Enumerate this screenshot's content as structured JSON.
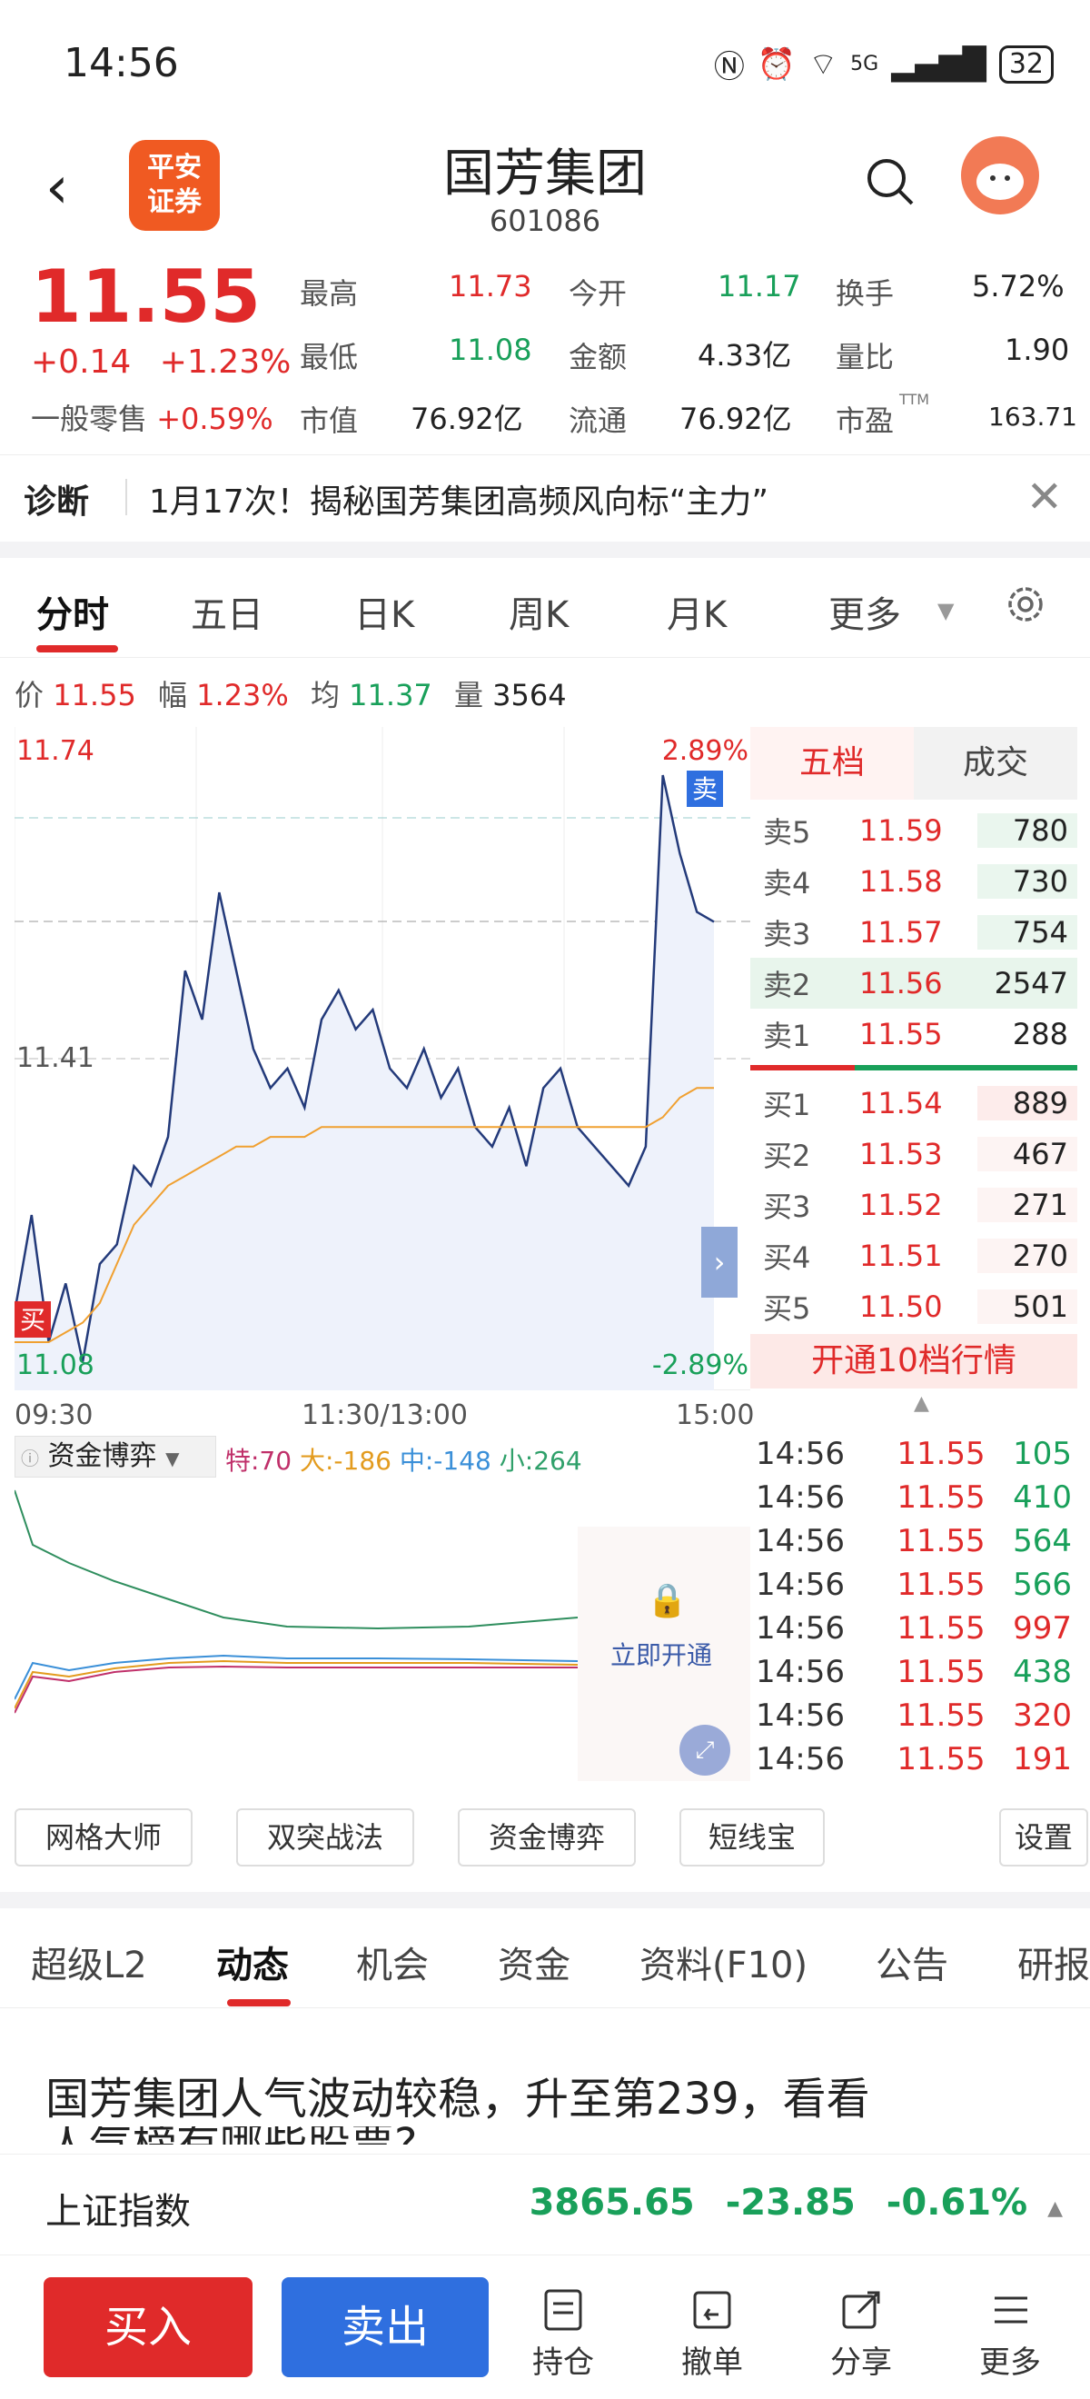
{
  "status_bar": {
    "time": "14:56",
    "network": "5G",
    "battery": "32"
  },
  "header": {
    "stock_name": "国芳集团",
    "stock_code": "601086",
    "logo_line1": "平安",
    "logo_line2": "证券"
  },
  "quote": {
    "price": "11.55",
    "change": "+0.14",
    "change_pct": "+1.23%",
    "retail_label": "一般零售",
    "retail_pct": "+0.59%",
    "high_label": "最高",
    "high": "11.73",
    "low_label": "最低",
    "low": "11.08",
    "cap_label": "市值",
    "cap": "76.92亿",
    "open_label": "今开",
    "open": "11.17",
    "amount_label": "金额",
    "amount": "4.33亿",
    "float_label": "流通",
    "float": "76.92亿",
    "turnover_label": "换手",
    "turnover": "5.72%",
    "vr_label": "量比",
    "vr": "1.90",
    "pe_label": "市盈",
    "pe_sup": "TTM",
    "pe": "163.71"
  },
  "diagnosis": {
    "label": "诊断",
    "text": "1月17次！揭秘国芳集团高频风向标“主力”"
  },
  "tabs": [
    "分时",
    "五日",
    "日K",
    "周K",
    "月K",
    "更多"
  ],
  "info_line": {
    "price_label": "价",
    "price": "11.55",
    "amp_label": "幅",
    "amp": "1.23%",
    "avg_label": "均",
    "avg": "11.37",
    "vol_label": "量",
    "vol": "3564"
  },
  "chart_labels": {
    "top_price": "11.74",
    "mid_price": "11.41",
    "bottom_price": "11.08",
    "top_pct": "2.89%",
    "bottom_pct": "-2.89%",
    "sell_marker": "卖",
    "buy_marker": "买"
  },
  "chart_data": {
    "type": "line",
    "x_ticks": [
      "09:30",
      "11:30/13:00",
      "15:00"
    ],
    "ylim": [
      11.08,
      11.74
    ],
    "series": [
      {
        "name": "价",
        "values": [
          11.15,
          11.25,
          11.12,
          11.18,
          11.1,
          11.2,
          11.22,
          11.3,
          11.28,
          11.33,
          11.5,
          11.45,
          11.58,
          11.5,
          11.42,
          11.38,
          11.4,
          11.36,
          11.45,
          11.48,
          11.44,
          11.46,
          11.4,
          11.38,
          11.42,
          11.37,
          11.4,
          11.34,
          11.32,
          11.36,
          11.3,
          11.38,
          11.4,
          11.34,
          11.32,
          11.3,
          11.28,
          11.32,
          11.7,
          11.62,
          11.56,
          11.55
        ]
      },
      {
        "name": "均",
        "values": [
          11.12,
          11.12,
          11.12,
          11.13,
          11.14,
          11.16,
          11.2,
          11.24,
          11.26,
          11.28,
          11.29,
          11.3,
          11.31,
          11.32,
          11.32,
          11.33,
          11.33,
          11.33,
          11.34,
          11.34,
          11.34,
          11.34,
          11.34,
          11.34,
          11.34,
          11.34,
          11.34,
          11.34,
          11.34,
          11.34,
          11.34,
          11.34,
          11.34,
          11.34,
          11.34,
          11.34,
          11.34,
          11.34,
          11.35,
          11.37,
          11.38,
          11.38
        ]
      }
    ]
  },
  "order_book": {
    "tab_five": "五档",
    "tab_trades": "成交",
    "asks": [
      {
        "label": "卖5",
        "price": "11.59",
        "vol": "780"
      },
      {
        "label": "卖4",
        "price": "11.58",
        "vol": "730"
      },
      {
        "label": "卖3",
        "price": "11.57",
        "vol": "754"
      },
      {
        "label": "卖2",
        "price": "11.56",
        "vol": "2547"
      },
      {
        "label": "卖1",
        "price": "11.55",
        "vol": "288"
      }
    ],
    "bids": [
      {
        "label": "买1",
        "price": "11.54",
        "vol": "889"
      },
      {
        "label": "买2",
        "price": "11.53",
        "vol": "467"
      },
      {
        "label": "买3",
        "price": "11.52",
        "vol": "271"
      },
      {
        "label": "买4",
        "price": "11.51",
        "vol": "270"
      },
      {
        "label": "买5",
        "price": "11.50",
        "vol": "501"
      }
    ],
    "open10": "开通10档行情"
  },
  "fund_panel": {
    "title": "资金博弈",
    "special": "特:70",
    "large": "大:-186",
    "medium": "中:-148",
    "small": "小:264",
    "unlock": "立即开通"
  },
  "trades": [
    {
      "time": "14:56",
      "price": "11.55",
      "vol": "105",
      "color": "green"
    },
    {
      "time": "14:56",
      "price": "11.55",
      "vol": "410",
      "color": "green"
    },
    {
      "time": "14:56",
      "price": "11.55",
      "vol": "564",
      "color": "green"
    },
    {
      "time": "14:56",
      "price": "11.55",
      "vol": "566",
      "color": "green"
    },
    {
      "time": "14:56",
      "price": "11.55",
      "vol": "997",
      "color": "red"
    },
    {
      "time": "14:56",
      "price": "11.55",
      "vol": "438",
      "color": "green"
    },
    {
      "time": "14:56",
      "price": "11.55",
      "vol": "320",
      "color": "red"
    },
    {
      "time": "14:56",
      "price": "11.55",
      "vol": "191",
      "color": "red"
    }
  ],
  "tools": [
    "网格大师",
    "双突战法",
    "资金博弈",
    "短线宝",
    "设置"
  ],
  "bottom_tabs": [
    "超级L2",
    "动态",
    "机会",
    "资金",
    "资料(F10)",
    "公告",
    "研报"
  ],
  "news": {
    "headline": "国芳集团人气波动较稳，升至第239，看看",
    "headline2": "人气榜有哪些股票?"
  },
  "index_bar": {
    "name": "上证指数",
    "value": "3865.65",
    "change": "-23.85",
    "pct": "-0.61%"
  },
  "bottom_bar": {
    "buy": "买入",
    "sell": "卖出",
    "hold": "持仓",
    "cancel": "撤单",
    "share": "分享",
    "more": "更多"
  },
  "colors": {
    "up": "#e02a2a",
    "down": "#19a05a",
    "price_line": "#233a7a",
    "avg_line": "#f0a030",
    "sell_btn": "#2f6fdf"
  }
}
